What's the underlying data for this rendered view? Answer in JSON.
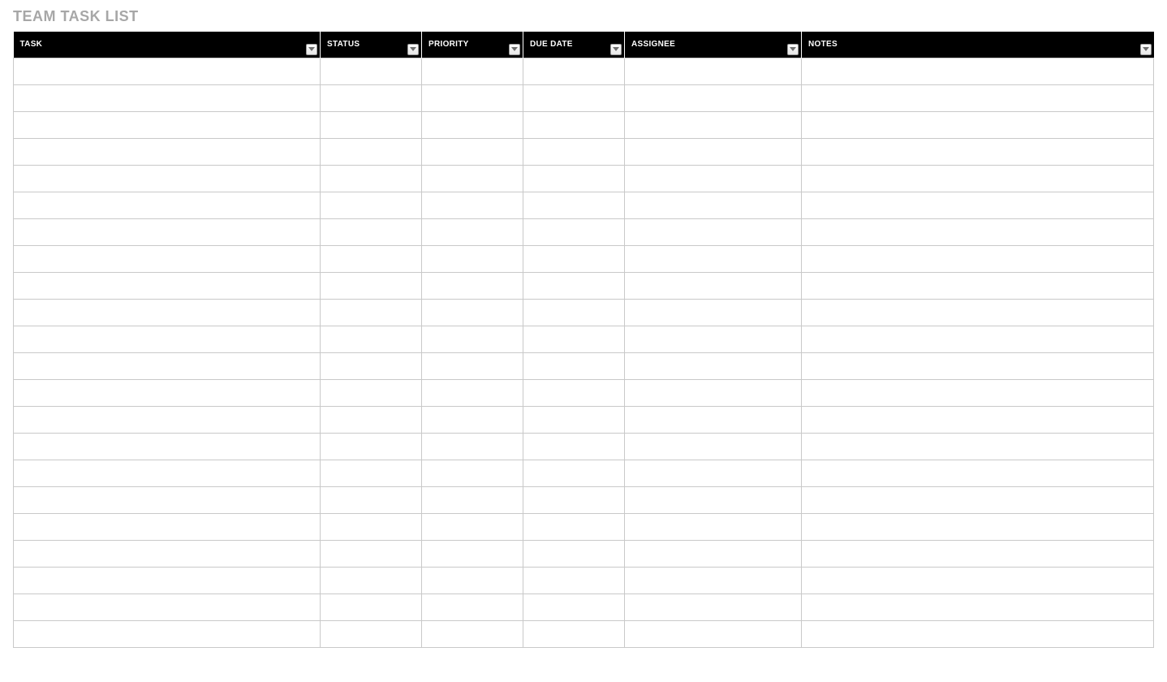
{
  "title": "TEAM TASK LIST",
  "columns": [
    {
      "key": "task",
      "label": "TASK"
    },
    {
      "key": "status",
      "label": "STATUS"
    },
    {
      "key": "priority",
      "label": "PRIORITY"
    },
    {
      "key": "due_date",
      "label": "DUE DATE"
    },
    {
      "key": "assignee",
      "label": "ASSIGNEE"
    },
    {
      "key": "notes",
      "label": "NOTES"
    }
  ],
  "rows": [
    {
      "task": "",
      "status": "",
      "priority": "",
      "due_date": "",
      "assignee": "",
      "notes": ""
    },
    {
      "task": "",
      "status": "",
      "priority": "",
      "due_date": "",
      "assignee": "",
      "notes": ""
    },
    {
      "task": "",
      "status": "",
      "priority": "",
      "due_date": "",
      "assignee": "",
      "notes": ""
    },
    {
      "task": "",
      "status": "",
      "priority": "",
      "due_date": "",
      "assignee": "",
      "notes": ""
    },
    {
      "task": "",
      "status": "",
      "priority": "",
      "due_date": "",
      "assignee": "",
      "notes": ""
    },
    {
      "task": "",
      "status": "",
      "priority": "",
      "due_date": "",
      "assignee": "",
      "notes": ""
    },
    {
      "task": "",
      "status": "",
      "priority": "",
      "due_date": "",
      "assignee": "",
      "notes": ""
    },
    {
      "task": "",
      "status": "",
      "priority": "",
      "due_date": "",
      "assignee": "",
      "notes": ""
    },
    {
      "task": "",
      "status": "",
      "priority": "",
      "due_date": "",
      "assignee": "",
      "notes": ""
    },
    {
      "task": "",
      "status": "",
      "priority": "",
      "due_date": "",
      "assignee": "",
      "notes": ""
    },
    {
      "task": "",
      "status": "",
      "priority": "",
      "due_date": "",
      "assignee": "",
      "notes": ""
    },
    {
      "task": "",
      "status": "",
      "priority": "",
      "due_date": "",
      "assignee": "",
      "notes": ""
    },
    {
      "task": "",
      "status": "",
      "priority": "",
      "due_date": "",
      "assignee": "",
      "notes": ""
    },
    {
      "task": "",
      "status": "",
      "priority": "",
      "due_date": "",
      "assignee": "",
      "notes": ""
    },
    {
      "task": "",
      "status": "",
      "priority": "",
      "due_date": "",
      "assignee": "",
      "notes": ""
    },
    {
      "task": "",
      "status": "",
      "priority": "",
      "due_date": "",
      "assignee": "",
      "notes": ""
    },
    {
      "task": "",
      "status": "",
      "priority": "",
      "due_date": "",
      "assignee": "",
      "notes": ""
    },
    {
      "task": "",
      "status": "",
      "priority": "",
      "due_date": "",
      "assignee": "",
      "notes": ""
    },
    {
      "task": "",
      "status": "",
      "priority": "",
      "due_date": "",
      "assignee": "",
      "notes": ""
    },
    {
      "task": "",
      "status": "",
      "priority": "",
      "due_date": "",
      "assignee": "",
      "notes": ""
    },
    {
      "task": "",
      "status": "",
      "priority": "",
      "due_date": "",
      "assignee": "",
      "notes": ""
    },
    {
      "task": "",
      "status": "",
      "priority": "",
      "due_date": "",
      "assignee": "",
      "notes": ""
    }
  ]
}
